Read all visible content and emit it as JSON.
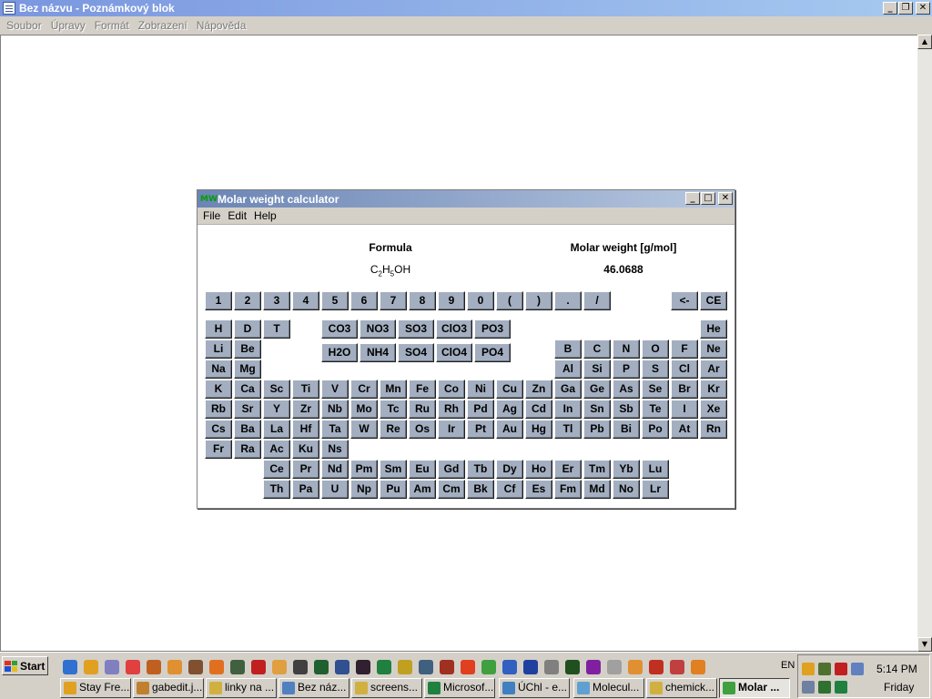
{
  "notepad": {
    "title": "Bez názvu - Poznámkový blok",
    "menu": [
      "Soubor",
      "Úpravy",
      "Formát",
      "Zobrazení",
      "Nápověda"
    ]
  },
  "molar": {
    "title": "Molar weight calculator",
    "menu": [
      "File",
      "Edit",
      "Help"
    ],
    "formula_label": "Formula",
    "weight_label": "Molar weight [g/mol]",
    "formula": {
      "p1": "C",
      "s1": "2",
      "p2": "H",
      "s2": "5",
      "p3": "OH"
    },
    "weight": "46.0688",
    "digit_keys": [
      "1",
      "2",
      "3",
      "4",
      "5",
      "6",
      "7",
      "8",
      "9",
      "0",
      "(",
      ")",
      ".",
      "/"
    ],
    "backspace": "<-",
    "clear": "CE",
    "groups_row1": [
      "CO3",
      "NO3",
      "SO3",
      "ClO3",
      "PO3"
    ],
    "groups_row2": [
      "H2O",
      "NH4",
      "SO4",
      "ClO4",
      "PO4"
    ],
    "elements": {
      "r1": [
        "H",
        "D",
        "T"
      ],
      "he": "He",
      "r2a": [
        "Li",
        "Be"
      ],
      "r2b": [
        "B",
        "C",
        "N",
        "O",
        "F",
        "Ne"
      ],
      "r3a": [
        "Na",
        "Mg"
      ],
      "r3b": [
        "Al",
        "Si",
        "P",
        "S",
        "Cl",
        "Ar"
      ],
      "r4": [
        "K",
        "Ca",
        "Sc",
        "Ti",
        "V",
        "Cr",
        "Mn",
        "Fe",
        "Co",
        "Ni",
        "Cu",
        "Zn",
        "Ga",
        "Ge",
        "As",
        "Se",
        "Br",
        "Kr"
      ],
      "r5": [
        "Rb",
        "Sr",
        "Y",
        "Zr",
        "Nb",
        "Mo",
        "Tc",
        "Ru",
        "Rh",
        "Pd",
        "Ag",
        "Cd",
        "In",
        "Sn",
        "Sb",
        "Te",
        "I",
        "Xe"
      ],
      "r6": [
        "Cs",
        "Ba",
        "La",
        "Hf",
        "Ta",
        "W",
        "Re",
        "Os",
        "Ir",
        "Pt",
        "Au",
        "Hg",
        "Tl",
        "Pb",
        "Bi",
        "Po",
        "At",
        "Rn"
      ],
      "r7": [
        "Fr",
        "Ra",
        "Ac",
        "Ku",
        "Ns"
      ],
      "lanth": [
        "Ce",
        "Pr",
        "Nd",
        "Pm",
        "Sm",
        "Eu",
        "Gd",
        "Tb",
        "Dy",
        "Ho",
        "Er",
        "Tm",
        "Yb",
        "Lu"
      ],
      "actin": [
        "Th",
        "Pa",
        "U",
        "Np",
        "Pu",
        "Am",
        "Cm",
        "Bk",
        "Cf",
        "Es",
        "Fm",
        "Md",
        "No",
        "Lr"
      ]
    }
  },
  "taskbar": {
    "start": "Start",
    "buttons": [
      "Stay Fre...",
      "gabedit.j...",
      "linky na ...",
      "Bez náz...",
      "screens...",
      "Microsof...",
      "ÚChl - e...",
      "Molecul...",
      "chemick...",
      "Molar ..."
    ],
    "lang": "EN",
    "time": "5:14 PM",
    "day": "Friday"
  }
}
